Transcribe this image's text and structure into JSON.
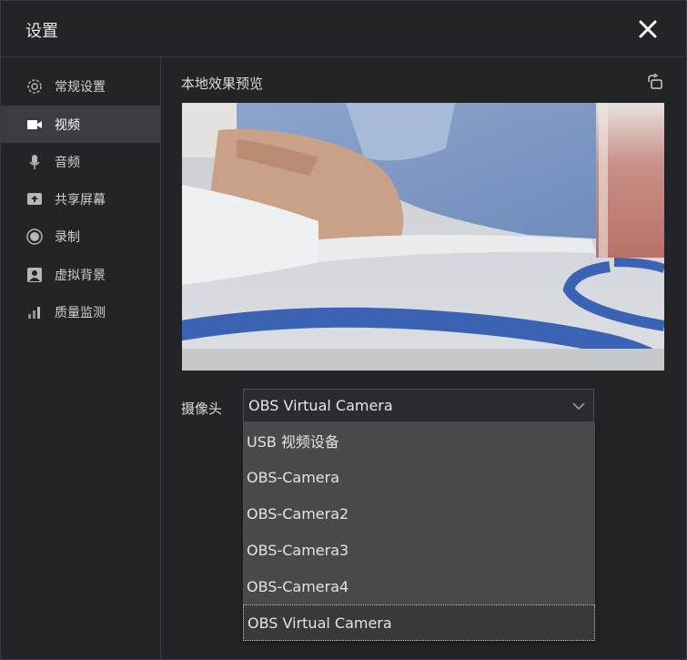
{
  "dialog": {
    "title": "设置"
  },
  "sidebar": {
    "items": [
      {
        "label": "常规设置",
        "icon": "gear-icon"
      },
      {
        "label": "视频",
        "icon": "video-camera-icon",
        "active": true
      },
      {
        "label": "音频",
        "icon": "microphone-icon"
      },
      {
        "label": "共享屏幕",
        "icon": "screen-share-icon"
      },
      {
        "label": "录制",
        "icon": "record-icon"
      },
      {
        "label": "虚拟背景",
        "icon": "virtual-background-icon"
      },
      {
        "label": "质量监测",
        "icon": "signal-bars-icon"
      }
    ]
  },
  "main": {
    "preview_title": "本地效果预览",
    "camera_label": "摄像头",
    "camera_select": {
      "selected": "OBS Virtual Camera",
      "options": [
        "USB 视频设备",
        "OBS-Camera",
        "OBS-Camera2",
        "OBS-Camera3",
        "OBS-Camera4",
        "OBS Virtual Camera"
      ]
    }
  },
  "colors": {
    "background": "#232428",
    "active_nav": "#3b3c42",
    "dropdown": "#48494d"
  }
}
